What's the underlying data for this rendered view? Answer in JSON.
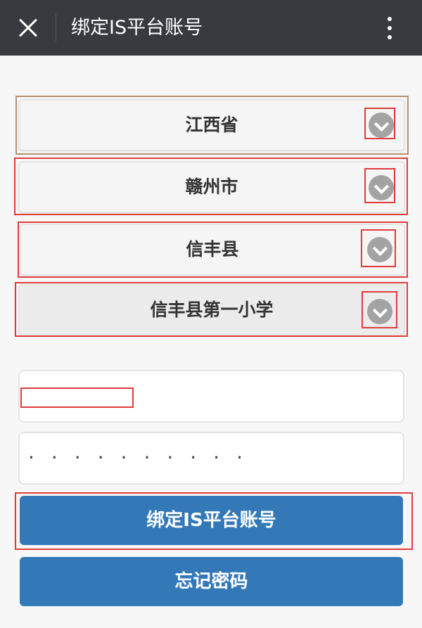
{
  "header": {
    "title": "绑定IS平台账号"
  },
  "selects": {
    "province": "江西省",
    "city": "赣州市",
    "county": "信丰县",
    "school": "信丰县第一小学"
  },
  "inputs": {
    "username_value": "",
    "password_value": "··········"
  },
  "buttons": {
    "bind_label": "绑定IS平台账号",
    "forgot_label": "忘记密码"
  },
  "colors": {
    "header_bg": "#393a3f",
    "button_bg": "#3379b8",
    "annotation_red": "#e03c3c"
  }
}
